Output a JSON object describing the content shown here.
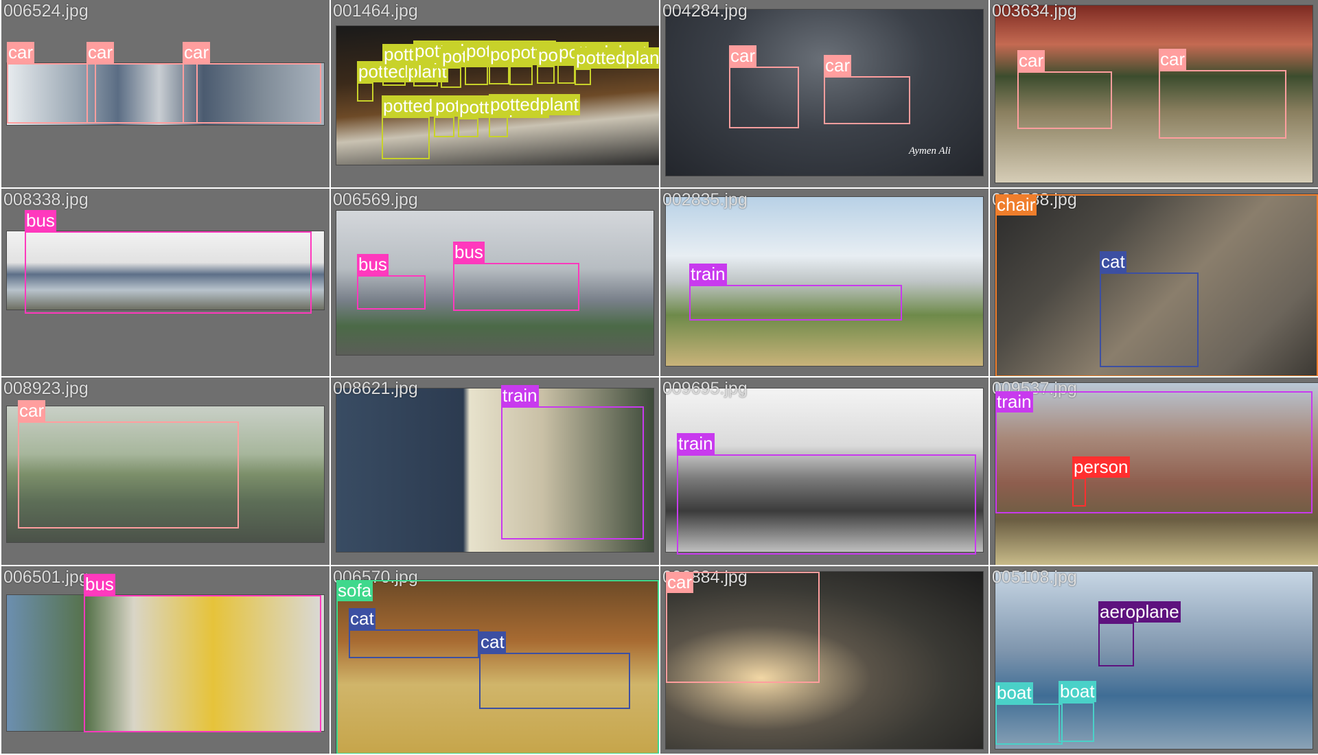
{
  "grid": {
    "columns": 4,
    "rows": 4
  },
  "class_colors": {
    "car": "#ff9e9e",
    "pottedplant": "#c8d22a",
    "bus": "#ff39bd",
    "train": "#c83aee",
    "chair": "#ef7e2c",
    "cat": "#3c4fa2",
    "person": "#ff2f2f",
    "sofa": "#3fd88c",
    "aeroplane": "#5e127e",
    "boat": "#4ad1c8"
  },
  "tiles": [
    {
      "filename": "006524.jpg",
      "scene": "three parked cars, side view",
      "detections": [
        {
          "label": "car"
        },
        {
          "label": "car"
        },
        {
          "label": "car"
        }
      ]
    },
    {
      "filename": "001464.jpg",
      "scene": "room interior with many potted plants on a shelf",
      "detections": [
        {
          "label": "pottedplant"
        },
        {
          "label": "pottedplant"
        },
        {
          "label": "pottedplant"
        },
        {
          "label": "pottedplant"
        },
        {
          "label": "pottedplant"
        },
        {
          "label": "pottedplant"
        },
        {
          "label": "pottedplant"
        },
        {
          "label": "pottedplant"
        },
        {
          "label": "pottedplant"
        },
        {
          "label": "pottedplant"
        },
        {
          "label": "pottedplant"
        },
        {
          "label": "pottedplant"
        },
        {
          "label": "pottedplant"
        },
        {
          "label": "pottedplant"
        }
      ]
    },
    {
      "filename": "004284.jpg",
      "scene": "two cars on a wet road at dusk",
      "watermark": "Aymen Ali",
      "detections": [
        {
          "label": "car"
        },
        {
          "label": "car"
        }
      ]
    },
    {
      "filename": "003634.jpg",
      "scene": "two old cars parked in front of a building",
      "detections": [
        {
          "label": "car"
        },
        {
          "label": "car"
        }
      ]
    },
    {
      "filename": "008338.jpg",
      "scene": "graffiti-covered bus behind a fence",
      "detections": [
        {
          "label": "bus"
        }
      ]
    },
    {
      "filename": "006569.jpg",
      "scene": "two yellow buses in fog near a depot",
      "detections": [
        {
          "label": "bus"
        },
        {
          "label": "bus"
        }
      ]
    },
    {
      "filename": "002835.jpg",
      "scene": "green steam train crossing a field",
      "detections": [
        {
          "label": "train"
        }
      ]
    },
    {
      "filename": "003788.jpg",
      "scene": "grey and white cat grooming on a sofa",
      "detections": [
        {
          "label": "chair"
        },
        {
          "label": "cat"
        }
      ]
    },
    {
      "filename": "008923.jpg",
      "scene": "red sports car on a track",
      "detections": [
        {
          "label": "car"
        }
      ]
    },
    {
      "filename": "008621.jpg",
      "scene": "locomotive 03079 with striped diesel shunter",
      "detections": [
        {
          "label": "train"
        }
      ]
    },
    {
      "filename": "009695.jpg",
      "scene": "black and white photo of a steam locomotive",
      "detections": [
        {
          "label": "train"
        }
      ]
    },
    {
      "filename": "009537.jpg",
      "scene": "rusty steam locomotive with a person in front",
      "detections": [
        {
          "label": "train"
        },
        {
          "label": "person"
        }
      ]
    },
    {
      "filename": "006501.jpg",
      "scene": "white and yellow city bus at a stop",
      "detections": [
        {
          "label": "bus"
        }
      ]
    },
    {
      "filename": "006570.jpg",
      "scene": "two cats lying on a floral sofa",
      "detections": [
        {
          "label": "sofa"
        },
        {
          "label": "cat"
        },
        {
          "label": "cat"
        }
      ]
    },
    {
      "filename": "006884.jpg",
      "scene": "dark car with headlights in a parking garage",
      "detections": [
        {
          "label": "car"
        }
      ]
    },
    {
      "filename": "005108.jpg",
      "scene": "air race plane near a pylon with boats and skyline",
      "detections": [
        {
          "label": "aeroplane"
        },
        {
          "label": "boat"
        },
        {
          "label": "boat"
        }
      ]
    }
  ]
}
